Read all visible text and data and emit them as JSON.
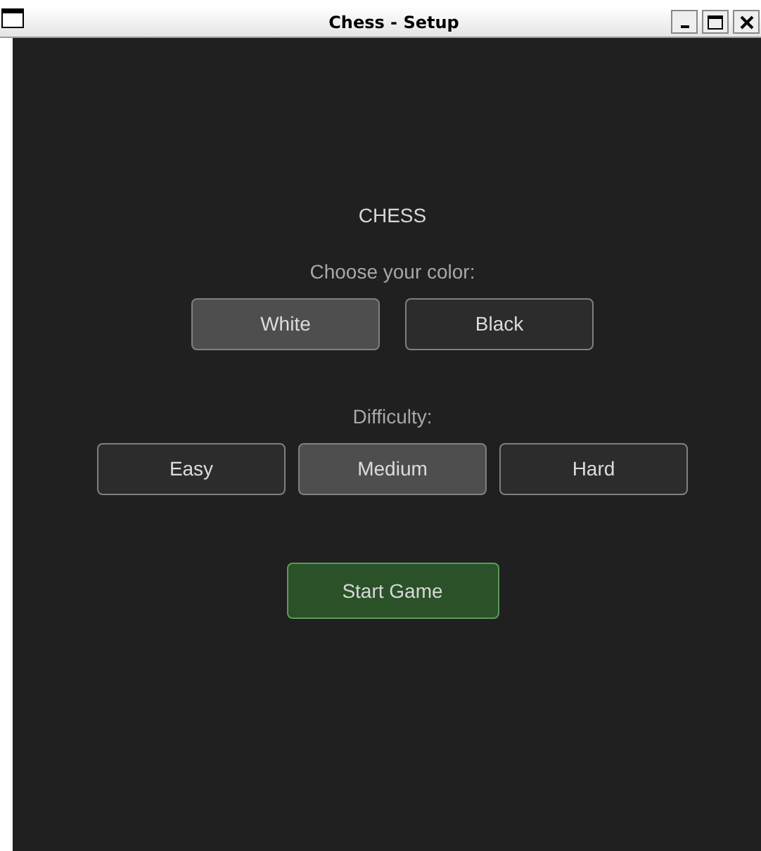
{
  "window": {
    "title": "Chess - Setup"
  },
  "heading": "CHESS",
  "color_prompt": "Choose your color:",
  "colors": [
    {
      "label": "White",
      "selected": true
    },
    {
      "label": "Black",
      "selected": false
    }
  ],
  "difficulty_prompt": "Difficulty:",
  "difficulties": [
    {
      "label": "Easy",
      "selected": false
    },
    {
      "label": "Medium",
      "selected": true
    },
    {
      "label": "Hard",
      "selected": false
    }
  ],
  "start_button": "Start Game"
}
